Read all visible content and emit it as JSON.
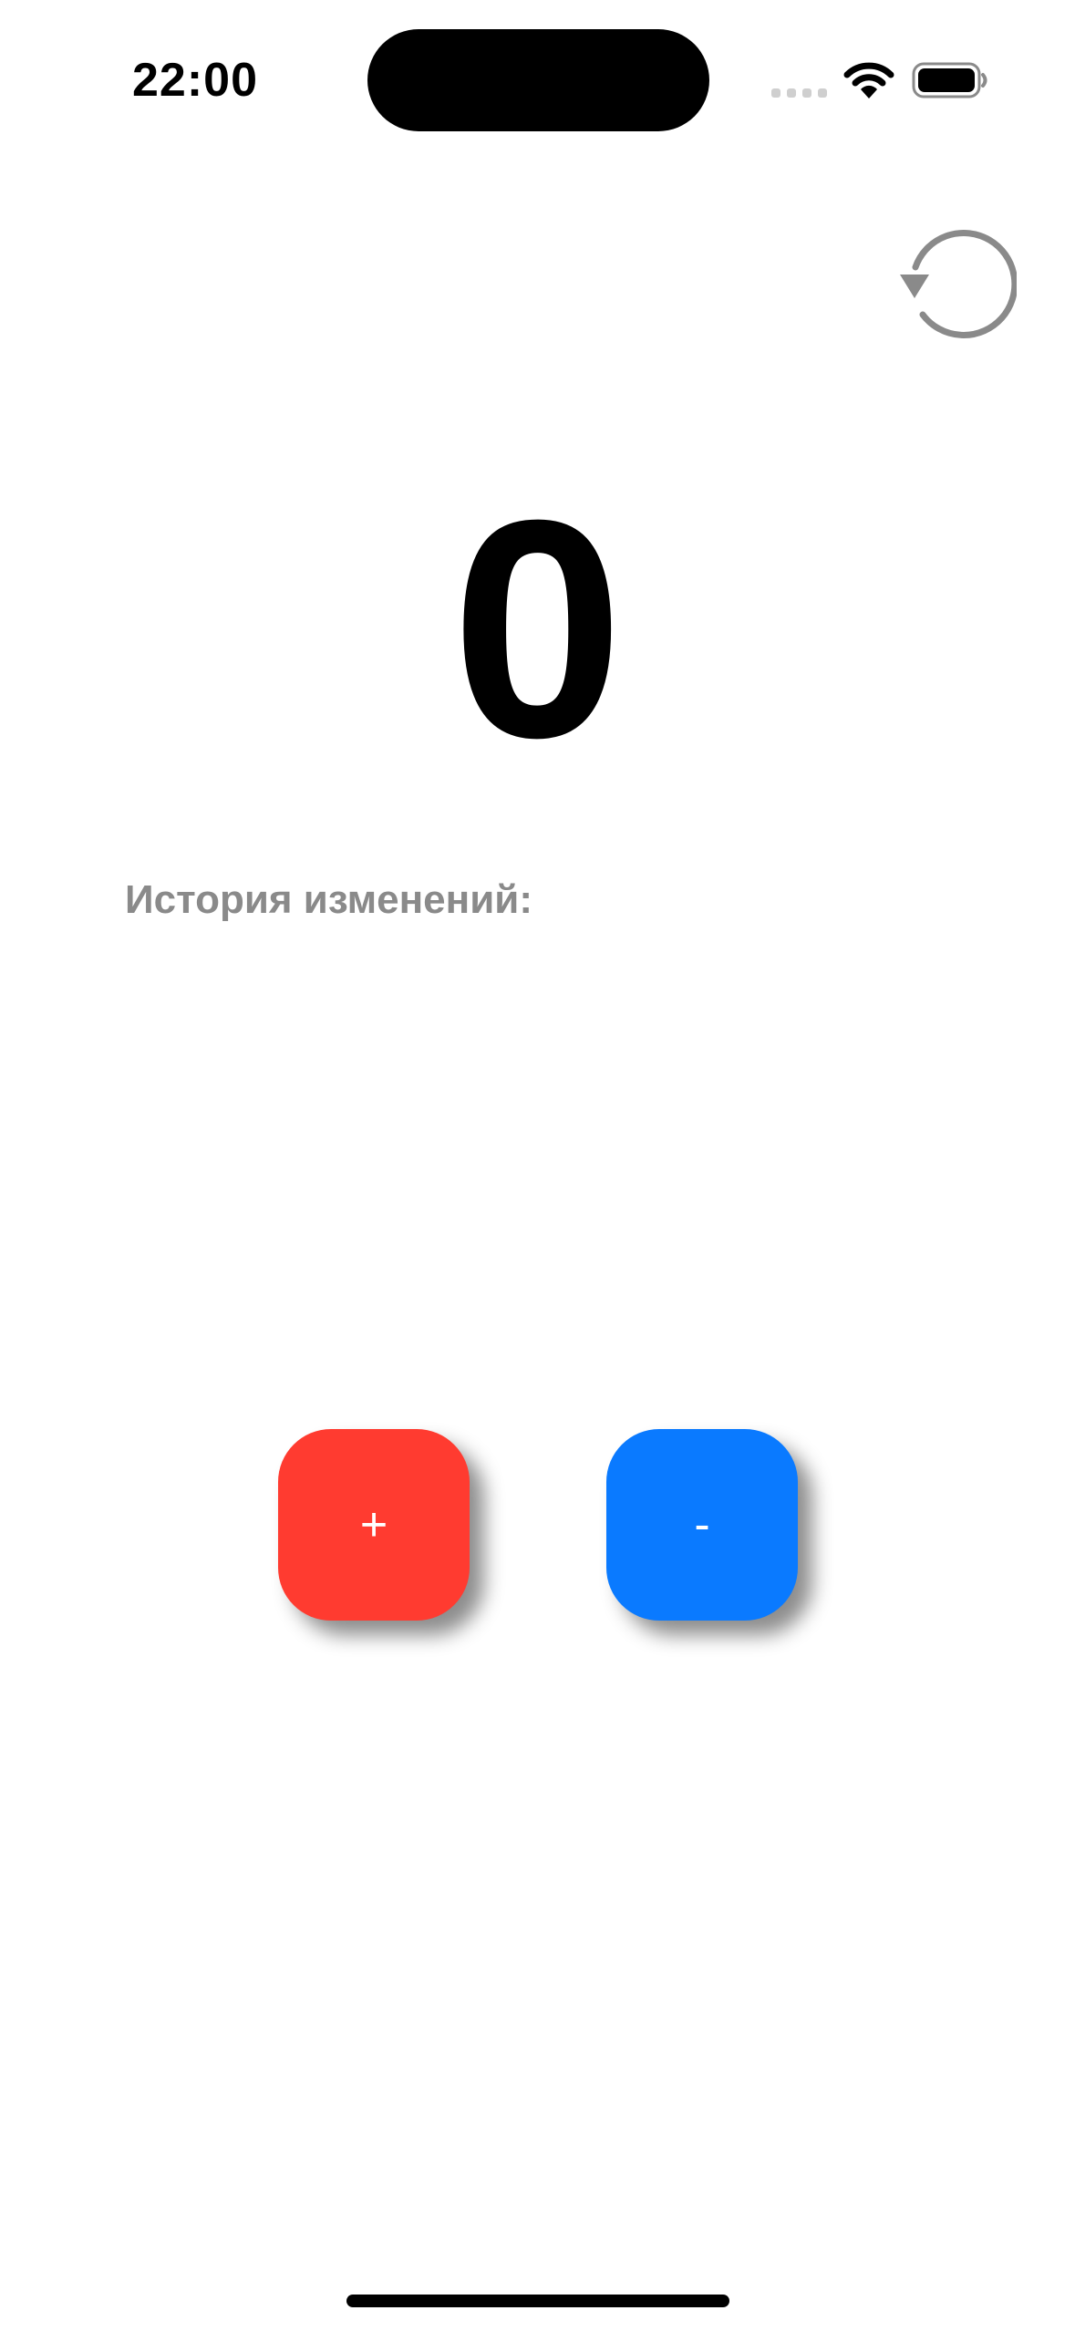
{
  "status_bar": {
    "time": "22:00",
    "wifi_icon": "wifi-icon",
    "battery_icon": "battery-icon",
    "signal_icon": "cellular-signal-icon"
  },
  "toolbar": {
    "reset_icon": "counterclockwise-arrow-icon",
    "reset_icon_color": "#8a8a8a"
  },
  "counter": {
    "value": "0"
  },
  "history": {
    "title": "История изменений:",
    "items": []
  },
  "controls": {
    "plus_label": "+",
    "plus_color": "#ff3b30",
    "minus_label": "-",
    "minus_color": "#0a7aff"
  }
}
